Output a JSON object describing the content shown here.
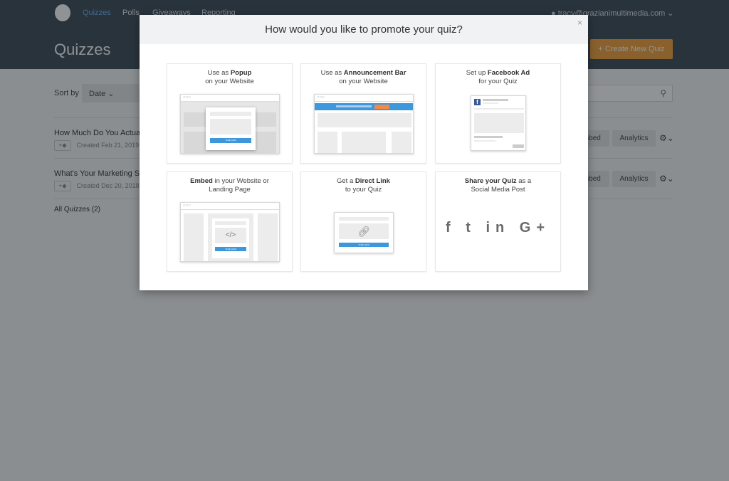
{
  "nav": {
    "items": [
      "Quizzes",
      "Polls",
      "Giveaways",
      "Reporting"
    ],
    "active": "Quizzes",
    "user_email": "tracy@grazianimultimedia.com"
  },
  "page": {
    "title": "Quizzes",
    "create_label": "+ Create New Quiz",
    "sort_label": "Sort by",
    "sort_value": "Date",
    "search_icon": "search-icon"
  },
  "quizzes": [
    {
      "title": "How Much Do You Actually Know...",
      "created": "Created Feb 21, 2019",
      "embed": "Embed",
      "analytics": "Analytics"
    },
    {
      "title": "What's Your Marketing Style...",
      "created": "Created Dec 20, 2018",
      "embed": "Embed",
      "analytics": "Analytics"
    }
  ],
  "all_quizzes": "All Quizzes (2)",
  "modal": {
    "title": "How would you like to promote your quiz?",
    "close": "×",
    "options": [
      {
        "pre": "Use as ",
        "bold": "Popup",
        "post": "on your Website",
        "button": "TAKE QUIZ"
      },
      {
        "pre": "Use as ",
        "bold": "Announcement Bar",
        "post": "on your Website"
      },
      {
        "pre": "Set up ",
        "bold": "Facebook Ad",
        "post": "for your Quiz"
      },
      {
        "pre": "",
        "bold": "Embed",
        "mid": " in your Website or",
        "post": "Landing Page",
        "button": "TAKE QUIZ"
      },
      {
        "pre": "Get a ",
        "bold": "Direct Link",
        "post": "to your Quiz",
        "button": "TAKE QUIZ"
      },
      {
        "pre": "",
        "bold": "Share your Quiz",
        "mid": " as a",
        "post": "Social Media Post",
        "icons": [
          "f",
          "t",
          "in",
          "G+"
        ]
      }
    ]
  },
  "colors": {
    "accent": "#f3a13b",
    "blue": "#3d97dc",
    "orange": "#f08a4b"
  }
}
